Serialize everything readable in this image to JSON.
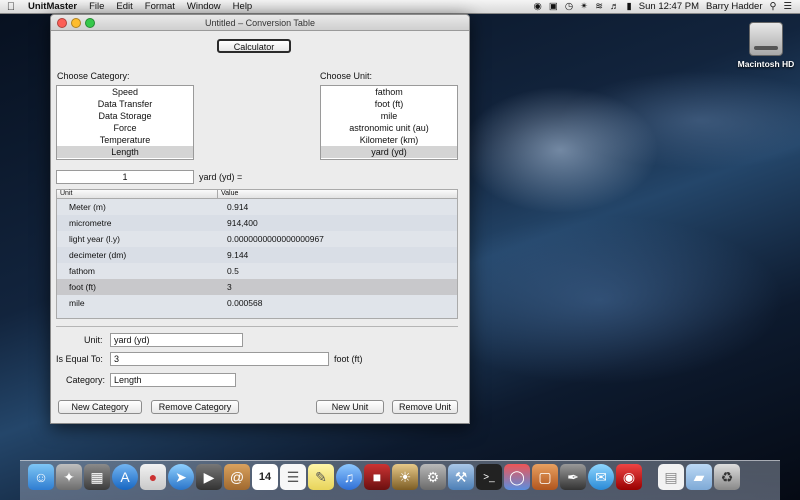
{
  "menubar": {
    "apple": "",
    "app": "UnitMaster",
    "items": [
      "File",
      "Edit",
      "Format",
      "Window",
      "Help"
    ],
    "clock": "Sun 12:47 PM",
    "user": "Barry Hadder"
  },
  "desktop": {
    "drive_label": "Macintosh HD"
  },
  "window": {
    "title": "Untitled – Conversion Table",
    "calculator_label": "Calculator",
    "choose_category_label": "Choose Category:",
    "choose_unit_label": "Choose Unit:",
    "categories": [
      "Speed",
      "Data Transfer",
      "Data Storage",
      "Force",
      "Temperature",
      "Length"
    ],
    "selected_category": "Length",
    "units": [
      "fathom",
      "foot (ft)",
      "mile",
      "astronomic unit (au)",
      "Kilometer (km)",
      "yard (yd)"
    ],
    "selected_unit": "yard (yd)",
    "amount": "1",
    "amount_unit_label": "yard (yd) =",
    "table": {
      "headers": [
        "Unit",
        "Value"
      ],
      "rows": [
        {
          "unit": "Meter (m)",
          "value": "0.914"
        },
        {
          "unit": "micrometre",
          "value": "914,400"
        },
        {
          "unit": "light year (l.y)",
          "value": "0.0000000000000000967"
        },
        {
          "unit": "decimeter (dm)",
          "value": "9.144"
        },
        {
          "unit": "fathom",
          "value": "0.5"
        },
        {
          "unit": "foot (ft)",
          "value": "3"
        },
        {
          "unit": "mile",
          "value": "0.000568"
        }
      ],
      "selected_row": 5
    },
    "detail": {
      "unit_label": "Unit:",
      "unit_value": "yard (yd)",
      "equal_label": "Is Equal To:",
      "equal_value": "3",
      "equal_unit": "foot (ft)",
      "category_label": "Category:",
      "category_value": "Length"
    },
    "buttons": {
      "new_category": "New Category",
      "remove_category": "Remove Category",
      "new_unit": "New Unit",
      "remove_unit": "Remove Unit"
    }
  },
  "dock": {
    "icons": [
      "finder-icon",
      "launchpad-icon",
      "mission-control-icon",
      "app-store-icon",
      "calendar-icon",
      "safari-icon",
      "facetime-icon",
      "contacts-icon",
      "ical-icon",
      "reminders-icon",
      "notes-icon",
      "itunes-icon",
      "photo-booth-icon",
      "iphoto-icon",
      "system-preferences-icon",
      "xcode-icon",
      "terminal-icon",
      "ring-icon",
      "preview-icon",
      "inkscape-icon",
      "messages-icon",
      "camera-icon",
      "document-icon",
      "folder-icon",
      "trash-icon"
    ]
  }
}
